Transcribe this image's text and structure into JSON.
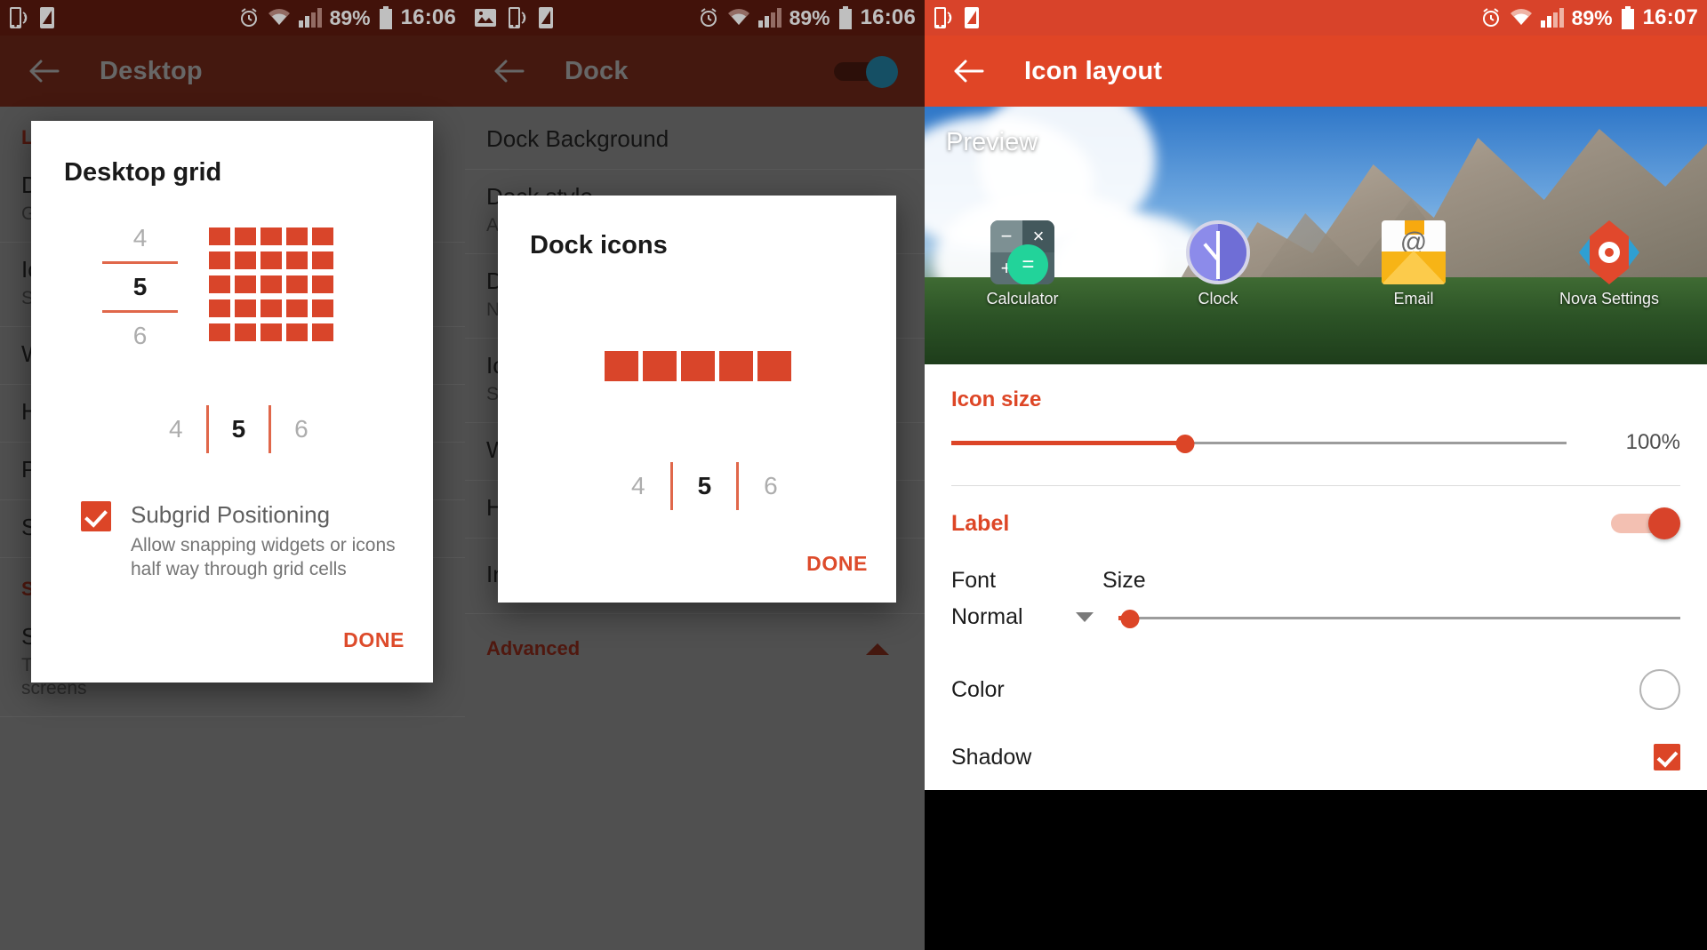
{
  "panels": [
    {
      "id": "desktop",
      "statusbar": {
        "time": "16:06",
        "battery_pct": "89%",
        "icons": [
          "cast-icon",
          "rotate-icon",
          "alarm-icon",
          "wifi-icon",
          "signal-icon",
          "battery-icon"
        ]
      },
      "appbar": {
        "title": "Desktop",
        "back_icon": "back-arrow-icon"
      },
      "background_list": {
        "section": "Layout",
        "rows": [
          {
            "title": "Desktop grid",
            "subtitle": "Grid size"
          },
          {
            "title": "Icon layout",
            "subtitle": "Size"
          },
          {
            "title": "Width padding",
            "subtitle": ""
          },
          {
            "title": "Height padding",
            "subtitle": ""
          },
          {
            "title": "Persistent search bar",
            "subtitle": ""
          },
          {
            "title": "Search bar style",
            "subtitle": ""
          }
        ],
        "section2": "Scrolling",
        "rows2": [
          {
            "title": "Scroll effect",
            "subtitle": "Transition effect when scrolling between home screens"
          }
        ]
      },
      "dialog": {
        "title": "Desktop grid",
        "rows_picker": {
          "above": "4",
          "selected": "5",
          "below": "6"
        },
        "cols_picker": {
          "left": "4",
          "selected": "5",
          "right": "6"
        },
        "grid_rows": 5,
        "grid_cols": 5,
        "subgrid": {
          "checked": true,
          "title": "Subgrid Positioning",
          "description": "Allow snapping widgets or icons half way through grid cells"
        },
        "done_label": "DONE"
      }
    },
    {
      "id": "dock",
      "statusbar": {
        "time": "16:06",
        "battery_pct": "89%",
        "icons": [
          "gallery-icon",
          "cast-icon",
          "rotate-icon",
          "alarm-icon",
          "wifi-icon",
          "signal-icon",
          "battery-icon"
        ]
      },
      "appbar": {
        "title": "Dock",
        "back_icon": "back-arrow-icon",
        "toggle_on": true
      },
      "background_list": {
        "rows": [
          {
            "title": "Dock Background",
            "subtitle": ""
          },
          {
            "title": "Dock style",
            "subtitle": "Apps"
          },
          {
            "title": "Dock icons",
            "subtitle": "Number of icons"
          },
          {
            "title": "Icon layout",
            "subtitle": "Size"
          },
          {
            "title": "Width padding",
            "subtitle": ""
          },
          {
            "title": "Height padding",
            "subtitle": ""
          },
          {
            "title": "Infinite scroll",
            "subtitle": ""
          }
        ],
        "section_advanced": "Advanced"
      },
      "dialog": {
        "title": "Dock icons",
        "cols_picker": {
          "left": "4",
          "selected": "5",
          "right": "6"
        },
        "grid_cols": 5,
        "done_label": "DONE"
      }
    },
    {
      "id": "icon-layout",
      "statusbar": {
        "time": "16:07",
        "battery_pct": "89%",
        "icons": [
          "cast-icon",
          "rotate-icon",
          "alarm-icon",
          "wifi-icon",
          "signal-icon",
          "battery-icon"
        ]
      },
      "appbar": {
        "title": "Icon layout",
        "back_icon": "back-arrow-icon"
      },
      "preview": {
        "label": "Preview",
        "apps": [
          {
            "name": "Calculator",
            "icon": "calculator-icon"
          },
          {
            "name": "Clock",
            "icon": "clock-icon"
          },
          {
            "name": "Email",
            "icon": "email-icon"
          },
          {
            "name": "Nova Settings",
            "icon": "nova-settings-icon"
          }
        ],
        "calculator_symbols": {
          "minus": "−",
          "times": "×",
          "plus": "+",
          "equals": "="
        },
        "email_symbol": "@"
      },
      "settings": {
        "icon_size_label": "Icon size",
        "icon_size_value": "100%",
        "icon_size_percent": 38,
        "label_label": "Label",
        "label_toggle_on": true,
        "font_header": "Font",
        "size_header": "Size",
        "font_value": "Normal",
        "font_size_percent": 2,
        "color_label": "Color",
        "color_value": "#ffffff",
        "shadow_label": "Shadow",
        "shadow_checked": true
      }
    }
  ],
  "theme": {
    "accent": "#dc4527",
    "appbar_bright": "#e04526",
    "statusbar_dark": "#58190e",
    "statusbar_bright": "#d8432a",
    "dim_overlay": "#6b6b6b"
  }
}
